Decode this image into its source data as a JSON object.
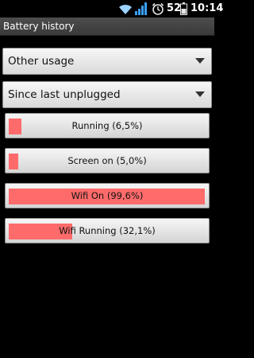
{
  "status_bar": {
    "battery_level": "52",
    "time": "10:14",
    "icons": [
      "wifi-icon",
      "signal-icon",
      "alarm-icon",
      "battery-icon"
    ]
  },
  "title": "Battery history",
  "spinners": {
    "type": "Other usage",
    "since": "Since last unplugged"
  },
  "usage_items": [
    {
      "label": "Running (6,5%)",
      "percent": 6.5
    },
    {
      "label": "Screen on (5,0%)",
      "percent": 5.0
    },
    {
      "label": "Wifi On (99,6%)",
      "percent": 99.6
    },
    {
      "label": "Wifi Running (32,1%)",
      "percent": 32.1
    }
  ],
  "colors": {
    "bar_fill": "#ff6b6b",
    "background": "#000000",
    "titlebar": "#444444"
  }
}
